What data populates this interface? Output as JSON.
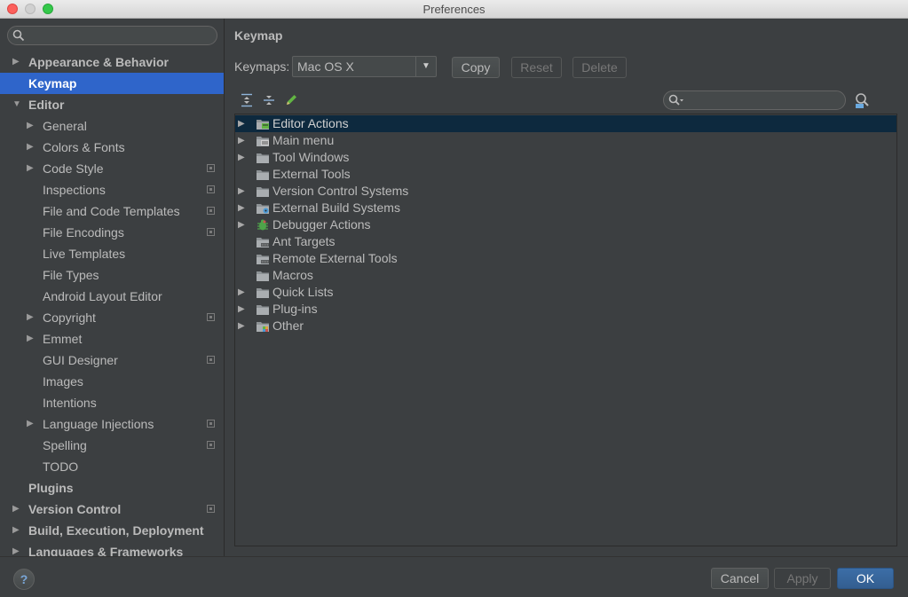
{
  "window": {
    "title": "Preferences"
  },
  "sidebar": {
    "search_value": "",
    "items": [
      {
        "label": "Appearance & Behavior",
        "level": 0,
        "arrow": "collapsed",
        "bold": true,
        "project": false,
        "selected": false
      },
      {
        "label": "Keymap",
        "level": 0,
        "arrow": "none",
        "bold": true,
        "project": false,
        "selected": true
      },
      {
        "label": "Editor",
        "level": 0,
        "arrow": "expanded",
        "bold": true,
        "project": false,
        "selected": false
      },
      {
        "label": "General",
        "level": 1,
        "arrow": "collapsed",
        "bold": false,
        "project": false,
        "selected": false
      },
      {
        "label": "Colors & Fonts",
        "level": 1,
        "arrow": "collapsed",
        "bold": false,
        "project": false,
        "selected": false
      },
      {
        "label": "Code Style",
        "level": 1,
        "arrow": "collapsed",
        "bold": false,
        "project": true,
        "selected": false
      },
      {
        "label": "Inspections",
        "level": 1,
        "arrow": "none",
        "bold": false,
        "project": true,
        "selected": false
      },
      {
        "label": "File and Code Templates",
        "level": 1,
        "arrow": "none",
        "bold": false,
        "project": true,
        "selected": false
      },
      {
        "label": "File Encodings",
        "level": 1,
        "arrow": "none",
        "bold": false,
        "project": true,
        "selected": false
      },
      {
        "label": "Live Templates",
        "level": 1,
        "arrow": "none",
        "bold": false,
        "project": false,
        "selected": false
      },
      {
        "label": "File Types",
        "level": 1,
        "arrow": "none",
        "bold": false,
        "project": false,
        "selected": false
      },
      {
        "label": "Android Layout Editor",
        "level": 1,
        "arrow": "none",
        "bold": false,
        "project": false,
        "selected": false
      },
      {
        "label": "Copyright",
        "level": 1,
        "arrow": "collapsed",
        "bold": false,
        "project": true,
        "selected": false
      },
      {
        "label": "Emmet",
        "level": 1,
        "arrow": "collapsed",
        "bold": false,
        "project": false,
        "selected": false
      },
      {
        "label": "GUI Designer",
        "level": 1,
        "arrow": "none",
        "bold": false,
        "project": true,
        "selected": false
      },
      {
        "label": "Images",
        "level": 1,
        "arrow": "none",
        "bold": false,
        "project": false,
        "selected": false
      },
      {
        "label": "Intentions",
        "level": 1,
        "arrow": "none",
        "bold": false,
        "project": false,
        "selected": false
      },
      {
        "label": "Language Injections",
        "level": 1,
        "arrow": "collapsed",
        "bold": false,
        "project": true,
        "selected": false
      },
      {
        "label": "Spelling",
        "level": 1,
        "arrow": "none",
        "bold": false,
        "project": true,
        "selected": false
      },
      {
        "label": "TODO",
        "level": 1,
        "arrow": "none",
        "bold": false,
        "project": false,
        "selected": false
      },
      {
        "label": "Plugins",
        "level": 0,
        "arrow": "none",
        "bold": true,
        "project": false,
        "selected": false
      },
      {
        "label": "Version Control",
        "level": 0,
        "arrow": "collapsed",
        "bold": true,
        "project": true,
        "selected": false
      },
      {
        "label": "Build, Execution, Deployment",
        "level": 0,
        "arrow": "collapsed",
        "bold": true,
        "project": false,
        "selected": false
      },
      {
        "label": "Languages & Frameworks",
        "level": 0,
        "arrow": "collapsed",
        "bold": true,
        "project": false,
        "selected": false
      }
    ]
  },
  "content": {
    "title": "Keymap",
    "keymaps_label": "Keymaps:",
    "keymap_selected": "Mac OS X",
    "buttons": {
      "copy": "Copy",
      "reset": "Reset",
      "delete": "Delete"
    },
    "find_value": "",
    "actions": [
      {
        "label": "Editor Actions",
        "arrow": true,
        "icon": "editor-folder-icon",
        "selected": true
      },
      {
        "label": "Main menu",
        "arrow": true,
        "icon": "menu-folder-icon",
        "selected": false
      },
      {
        "label": "Tool Windows",
        "arrow": true,
        "icon": "folder-icon",
        "selected": false
      },
      {
        "label": "External Tools",
        "arrow": false,
        "icon": "folder-icon",
        "selected": false
      },
      {
        "label": "Version Control Systems",
        "arrow": true,
        "icon": "folder-icon",
        "selected": false
      },
      {
        "label": "External Build Systems",
        "arrow": true,
        "icon": "build-folder-icon",
        "selected": false
      },
      {
        "label": "Debugger Actions",
        "arrow": true,
        "icon": "bug-icon",
        "selected": false
      },
      {
        "label": "Ant Targets",
        "arrow": false,
        "icon": "ant-folder-icon",
        "selected": false
      },
      {
        "label": "Remote External Tools",
        "arrow": false,
        "icon": "remote-folder-icon",
        "selected": false
      },
      {
        "label": "Macros",
        "arrow": false,
        "icon": "folder-icon",
        "selected": false
      },
      {
        "label": "Quick Lists",
        "arrow": true,
        "icon": "folder-icon",
        "selected": false
      },
      {
        "label": "Plug-ins",
        "arrow": true,
        "icon": "folder-icon",
        "selected": false
      },
      {
        "label": "Other",
        "arrow": true,
        "icon": "other-folder-icon",
        "selected": false
      }
    ]
  },
  "footer": {
    "help": "?",
    "cancel": "Cancel",
    "apply": "Apply",
    "ok": "OK"
  },
  "colors": {
    "background": "#3c3f41",
    "selection": "#2f65ca",
    "tree_selection": "#0d293e",
    "ok_button": "#3c6ea7"
  }
}
